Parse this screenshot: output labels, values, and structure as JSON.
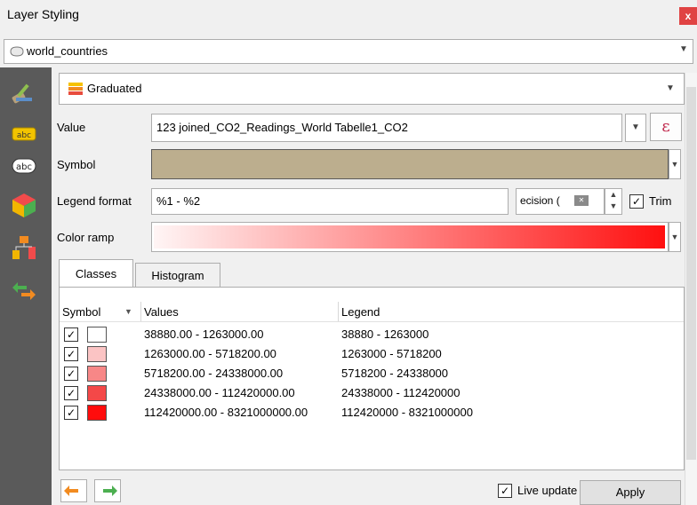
{
  "window": {
    "title": "Layer Styling",
    "close_glyph": "x"
  },
  "layer_selector": {
    "value": "world_countries",
    "icon": "polygon-layer-icon"
  },
  "sidebar": {
    "icons": [
      "paintbrush-icon",
      "labels-icon",
      "labels-abc-icon",
      "3d-cube-icon",
      "diagram-icon",
      "history-icon"
    ],
    "label_abc": "abc"
  },
  "renderer": {
    "value": "Graduated",
    "icon": "graduated-renderer-icon"
  },
  "form": {
    "value_label": "Value",
    "value_field": "123 joined_CO2_Readings_World Tabelle1_CO2",
    "expression_glyph": "ε",
    "symbol_label": "Symbol",
    "symbol_color": "#bcae8e",
    "legend_format_label": "Legend format",
    "legend_format_value": "%1 - %2",
    "precision_text": "ecision (",
    "trim_label": "Trim",
    "trim_checked": true,
    "color_ramp_label": "Color ramp",
    "color_ramp_start": "#fff5f5",
    "color_ramp_end": "#ff1010"
  },
  "tabs": [
    {
      "label": "Classes",
      "active": true
    },
    {
      "label": "Histogram",
      "active": false
    }
  ],
  "table": {
    "headers": {
      "symbol": "Symbol",
      "values": "Values",
      "legend": "Legend"
    },
    "rows": [
      {
        "checked": true,
        "color": "#ffffff",
        "values": "38880.00 - 1263000.00",
        "legend": "38880 - 1263000"
      },
      {
        "checked": true,
        "color": "#fbc4c4",
        "values": "1263000.00 - 5718200.00",
        "legend": "1263000 - 5718200"
      },
      {
        "checked": true,
        "color": "#f78787",
        "values": "5718200.00 - 24338000.00",
        "legend": "5718200 - 24338000"
      },
      {
        "checked": true,
        "color": "#f44848",
        "values": "24338000.00 - 112420000.00",
        "legend": "24338000 - 112420000"
      },
      {
        "checked": true,
        "color": "#ff0c0c",
        "values": "112420000.00 - 8321000000.00",
        "legend": "112420000 - 8321000000"
      }
    ]
  },
  "footer": {
    "live_update_label": "Live update",
    "live_update_checked": true,
    "apply_label": "Apply",
    "undo_icon": "undo-icon",
    "redo_icon": "redo-icon"
  },
  "check_glyph": "✓"
}
